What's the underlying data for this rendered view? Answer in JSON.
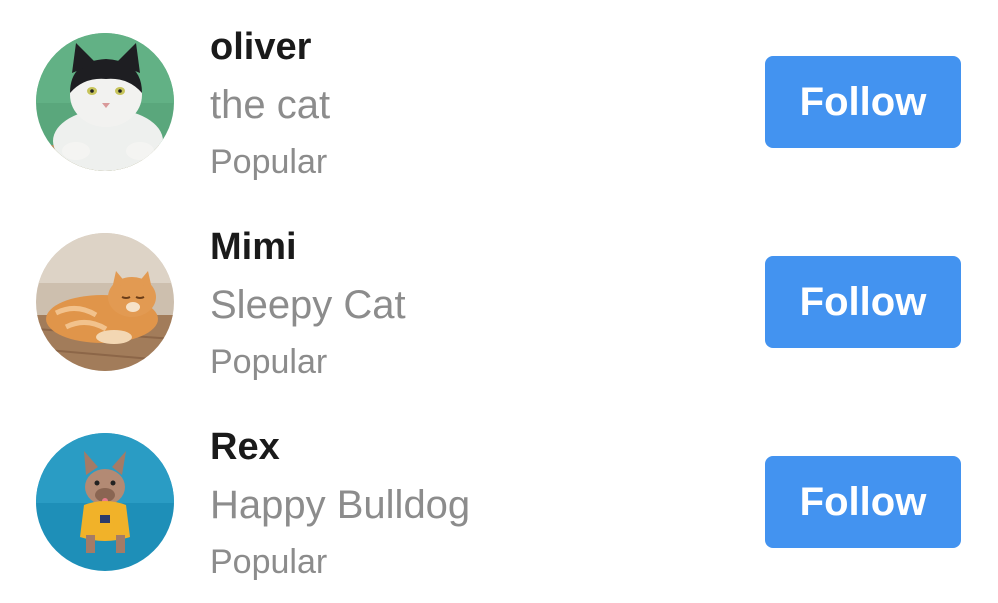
{
  "profiles": [
    {
      "name": "oliver",
      "subtitle": "the cat",
      "tag": "Popular",
      "follow_label": "Follow",
      "avatar": "black-and-white-cat-photo"
    },
    {
      "name": "Mimi",
      "subtitle": "Sleepy Cat",
      "tag": "Popular",
      "follow_label": "Follow",
      "avatar": "orange-tabby-cat-photo"
    },
    {
      "name": "Rex",
      "subtitle": "Happy Bulldog",
      "tag": "Popular",
      "follow_label": "Follow",
      "avatar": "french-bulldog-photo"
    }
  ],
  "colors": {
    "button": "#4393f0",
    "name": "#1a1a1a",
    "secondary_text": "#8c8c8c"
  }
}
